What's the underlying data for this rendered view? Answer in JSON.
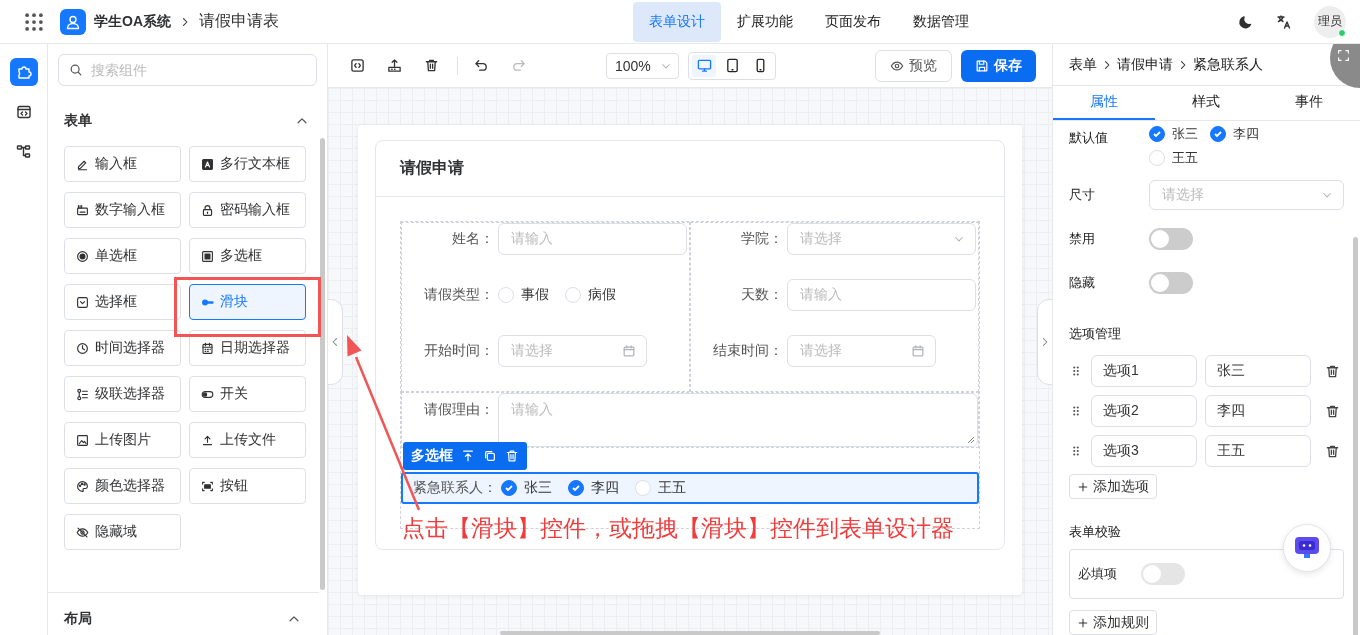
{
  "header": {
    "app_name": "学生OA系统",
    "page_title": "请假申请表",
    "nav": [
      {
        "label": "表单设计",
        "selected": true
      },
      {
        "label": "扩展功能",
        "selected": false
      },
      {
        "label": "页面发布",
        "selected": false
      },
      {
        "label": "数据管理",
        "selected": false
      }
    ],
    "avatar": "理员",
    "online": true
  },
  "rail": [
    {
      "kind": "components",
      "selected": true
    },
    {
      "kind": "code",
      "selected": false
    },
    {
      "kind": "tree",
      "selected": false
    }
  ],
  "components": {
    "search_placeholder": "搜索组件",
    "sections": [
      {
        "title": "表单",
        "expanded": true,
        "items": [
          {
            "kind": "input",
            "label": "输入框",
            "selected": false
          },
          {
            "kind": "textarea",
            "label": "多行文本框",
            "selected": false
          },
          {
            "kind": "number",
            "label": "数字输入框",
            "selected": false
          },
          {
            "kind": "password",
            "label": "密码输入框",
            "selected": false
          },
          {
            "kind": "radio",
            "label": "单选框",
            "selected": false
          },
          {
            "kind": "checkbox",
            "label": "多选框",
            "selected": false
          },
          {
            "kind": "select",
            "label": "选择框",
            "selected": false
          },
          {
            "kind": "slider",
            "label": "滑块",
            "selected": true
          },
          {
            "kind": "time",
            "label": "时间选择器",
            "selected": false
          },
          {
            "kind": "date",
            "label": "日期选择器",
            "selected": false
          },
          {
            "kind": "cascader",
            "label": "级联选择器",
            "selected": false
          },
          {
            "kind": "switch",
            "label": "开关",
            "selected": false
          },
          {
            "kind": "image",
            "label": "上传图片",
            "selected": false
          },
          {
            "kind": "file",
            "label": "上传文件",
            "selected": false
          },
          {
            "kind": "color",
            "label": "颜色选择器",
            "selected": false
          },
          {
            "kind": "button",
            "label": "按钮",
            "selected": false
          },
          {
            "kind": "hidden",
            "label": "隐藏域",
            "selected": false
          }
        ]
      },
      {
        "title": "布局",
        "expanded": true
      }
    ]
  },
  "toolbar": {
    "zoom": "100%",
    "devices": [
      {
        "kind": "desktop",
        "selected": true
      },
      {
        "kind": "tablet",
        "selected": false
      },
      {
        "kind": "phone",
        "selected": false
      }
    ],
    "preview": "预览",
    "save": "保存"
  },
  "form": {
    "title": "请假申请",
    "columns": [
      [
        {
          "kind": "input",
          "label": "姓名：",
          "placeholder": "请输入",
          "selected": false
        },
        {
          "kind": "radio",
          "label": "请假类型：",
          "selected": false,
          "options": [
            {
              "label": "事假",
              "checked": false
            },
            {
              "label": "病假",
              "checked": false
            }
          ]
        },
        {
          "kind": "date",
          "label": "开始时间：",
          "placeholder": "请选择",
          "selected": false
        }
      ],
      [
        {
          "kind": "select",
          "label": "学院：",
          "placeholder": "请选择",
          "selected": false
        },
        {
          "kind": "input",
          "label": "天数：",
          "placeholder": "请输入",
          "selected": false
        },
        {
          "kind": "date",
          "label": "结束时间：",
          "placeholder": "请选择",
          "selected": false
        }
      ]
    ],
    "rows": [
      {
        "kind": "textarea",
        "label": "请假理由：",
        "placeholder": "请输入",
        "selected": false
      },
      {
        "kind": "checkbox",
        "label": "紧急联系人：",
        "selected": true,
        "badge": "多选框",
        "options": [
          {
            "label": "张三",
            "checked": true
          },
          {
            "label": "李四",
            "checked": true
          },
          {
            "label": "王五",
            "checked": false
          }
        ]
      }
    ]
  },
  "annotation": "点击【滑块】控件，或拖拽【滑块】控件到表单设计器",
  "properties": {
    "breadcrumb": [
      "表单",
      "请假申请",
      "紧急联系人"
    ],
    "tabs": [
      {
        "label": "属性",
        "selected": true
      },
      {
        "label": "样式",
        "selected": false
      },
      {
        "label": "事件",
        "selected": false
      }
    ],
    "default_value": {
      "label": "默认值",
      "options": [
        {
          "label": "张三",
          "checked": true
        },
        {
          "label": "李四",
          "checked": true
        },
        {
          "label": "王五",
          "checked": false
        }
      ]
    },
    "size": {
      "label": "尺寸",
      "placeholder": "请选择"
    },
    "switches": [
      {
        "label": "禁用",
        "on": false
      },
      {
        "label": "隐藏",
        "on": false
      }
    ],
    "options": {
      "title": "选项管理",
      "items": [
        {
          "value": "选项1",
          "label": "张三"
        },
        {
          "value": "选项2",
          "label": "李四"
        },
        {
          "value": "选项3",
          "label": "王五"
        }
      ],
      "add": "添加选项"
    },
    "validation": {
      "title": "表单校验",
      "rules": [
        {
          "label": "必填项",
          "on": false
        }
      ],
      "add": "添加规则"
    }
  }
}
